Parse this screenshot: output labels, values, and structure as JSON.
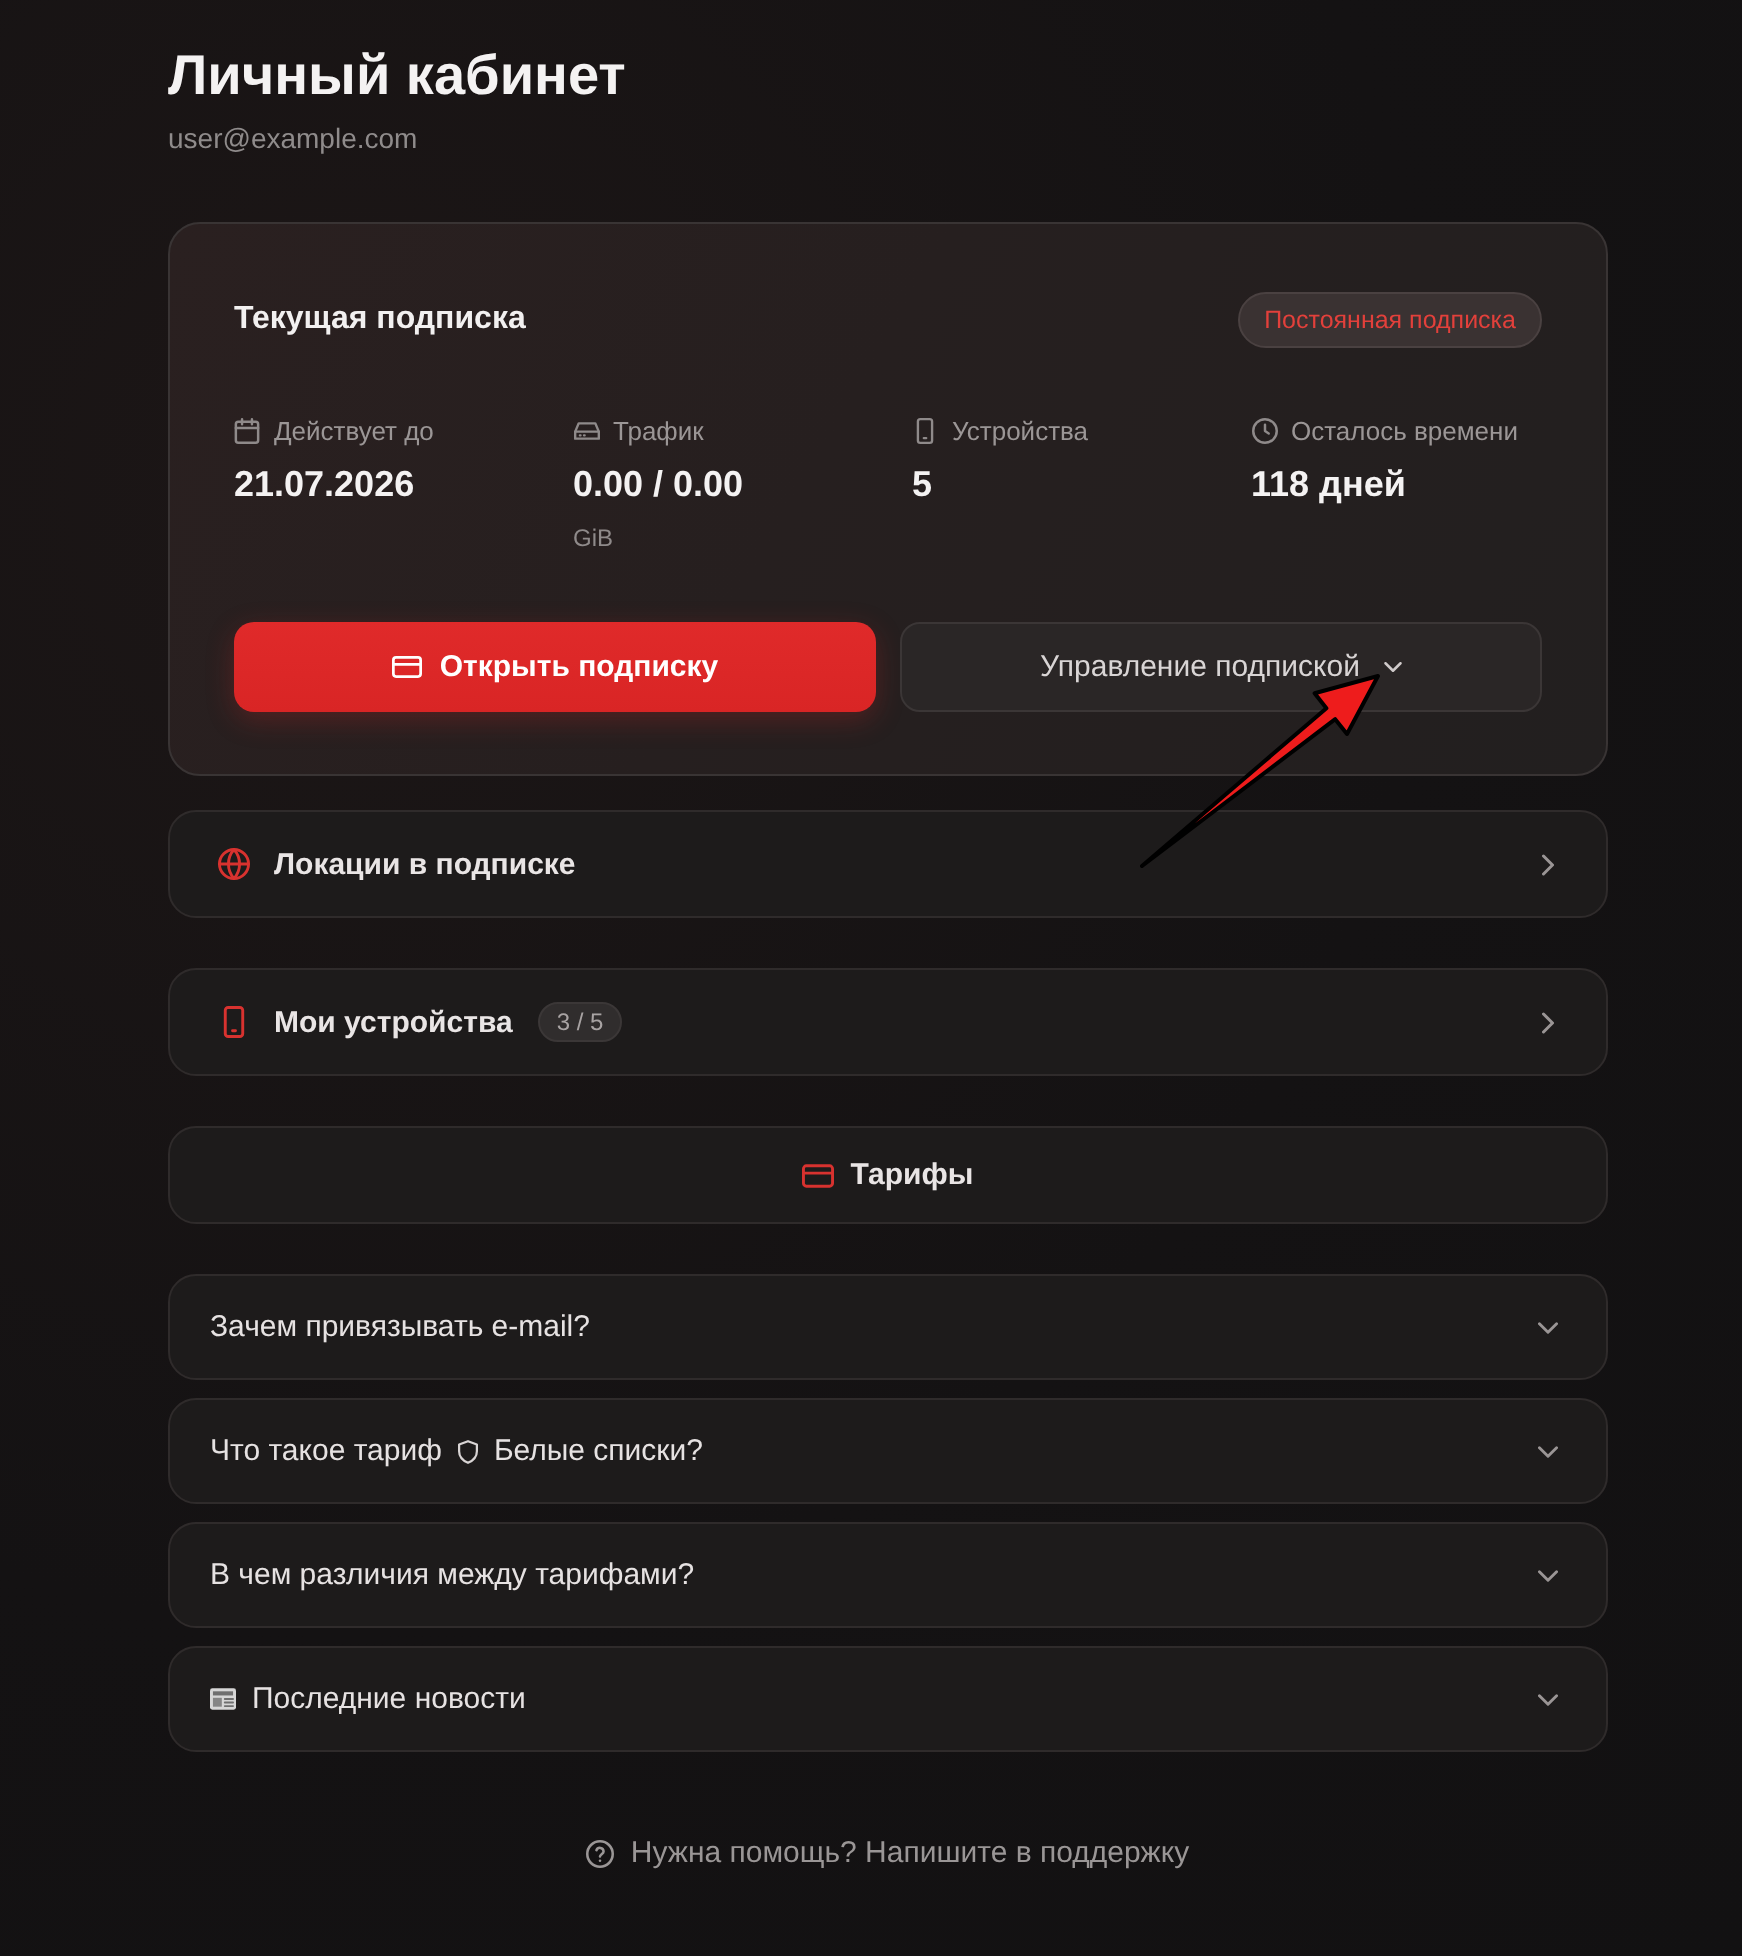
{
  "page": {
    "title": "Личный кабинет",
    "email": "user@example.com"
  },
  "subscription": {
    "title": "Текущая подписка",
    "badge": "Постоянная подписка",
    "stats": [
      {
        "label": "Действует до",
        "value": "21.07.2026"
      },
      {
        "label": "Трафик",
        "value": "0.00 / 0.00",
        "unit": "GiB"
      },
      {
        "label": "Устройства",
        "value": "5"
      },
      {
        "label": "Осталось времени",
        "value": "118 дней"
      }
    ],
    "buttons": [
      {
        "label": "Открыть подписку",
        "kind": "primary"
      },
      {
        "label": "Управление подпиской",
        "kind": "menu",
        "expanded": false
      }
    ]
  },
  "links": [
    {
      "label": "Локации в подписке"
    },
    {
      "label": "Мои устройства",
      "count": "3 / 5"
    }
  ],
  "tariffs_button": {
    "label": "Тарифы"
  },
  "faq": [
    {
      "kind": "plain",
      "question": "Зачем привязывать e-mail?",
      "expanded": false
    },
    {
      "kind": "inline_icon",
      "question": "Что такое тариф",
      "question_after": "Белые списки?",
      "expanded": false
    },
    {
      "kind": "plain",
      "question": "В чем различия между тарифами?",
      "expanded": false
    },
    {
      "kind": "lead_icon",
      "question": "Последние новости",
      "expanded": false
    }
  ],
  "help": {
    "label": "Нужна помощь? Напишите в поддержку"
  }
}
